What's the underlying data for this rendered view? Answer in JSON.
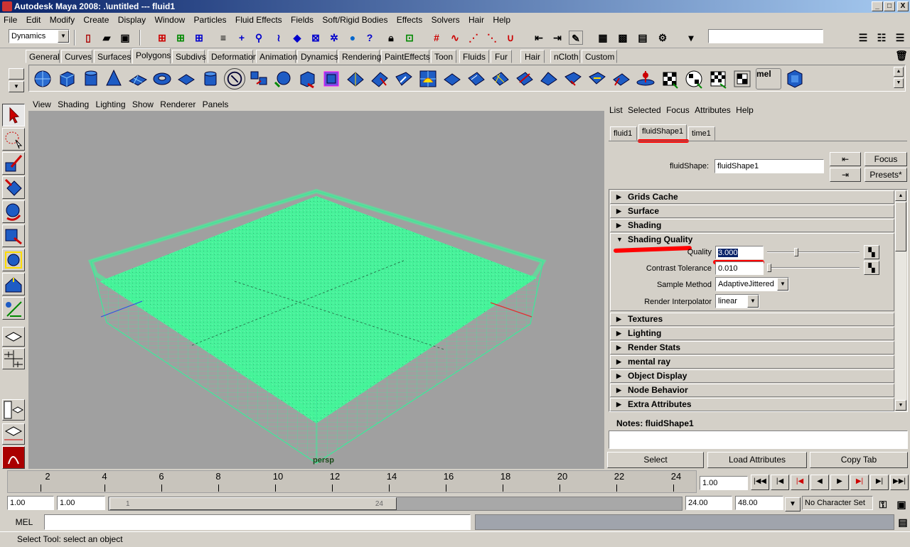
{
  "window": {
    "title": "Autodesk Maya 2008: .\\untitled   ---   fluid1",
    "min": "_",
    "max": "□",
    "close": "X"
  },
  "menubar": [
    "File",
    "Edit",
    "Modify",
    "Create",
    "Display",
    "Window",
    "Particles",
    "Fluid Effects",
    "Fields",
    "Soft/Rigid Bodies",
    "Effects",
    "Solvers",
    "Hair",
    "Help"
  ],
  "status": {
    "menuset": "Dynamics",
    "input_value": ""
  },
  "shelf_tabs": [
    "General",
    "Curves",
    "Surfaces",
    "Polygons",
    "Subdivs",
    "Deformation",
    "Animation",
    "Dynamics",
    "Rendering",
    "PaintEffects",
    "Toon",
    "Fluids",
    "Fur",
    "Hair",
    "nCloth",
    "Custom"
  ],
  "shelf_active": "Polygons",
  "shelf_mel": "mel",
  "panel_menu": [
    "View",
    "Shading",
    "Lighting",
    "Show",
    "Renderer",
    "Panels"
  ],
  "viewport": {
    "camera": "persp"
  },
  "attr_editor": {
    "menu": [
      "List",
      "Selected",
      "Focus",
      "Attributes",
      "Help"
    ],
    "tabs": [
      "fluid1",
      "fluidShape1",
      "time1"
    ],
    "active_tab": "fluidShape1",
    "node_label": "fluidShape:",
    "node_value": "fluidShape1",
    "focus_btn": "Focus",
    "presets_btn": "Presets*",
    "sections_top": [
      "Grids Cache",
      "Surface",
      "Shading"
    ],
    "open_section": "Shading Quality",
    "quality": {
      "label": "Quality",
      "value": "3.000"
    },
    "contrast": {
      "label": "Contrast Tolerance",
      "value": "0.010"
    },
    "sample": {
      "label": "Sample Method",
      "value": "AdaptiveJittered"
    },
    "interp": {
      "label": "Render Interpolator",
      "value": "linear"
    },
    "sections_bottom": [
      "Textures",
      "Lighting",
      "Render Stats",
      "mental ray",
      "Object Display",
      "Node Behavior",
      "Extra Attributes"
    ],
    "notes_label": "Notes:  fluidShape1",
    "select_btn": "Select",
    "load_btn": "Load Attributes",
    "copy_btn": "Copy Tab"
  },
  "timeline": {
    "ticks": [
      "2",
      "4",
      "6",
      "8",
      "10",
      "12",
      "14",
      "16",
      "18",
      "20",
      "22",
      "24"
    ],
    "current": "1.00"
  },
  "range": {
    "start": "1.00",
    "inner_start": "1.00",
    "slider_start": "1",
    "slider_end": "24",
    "end": "24.00",
    "outer_end": "48.00",
    "charset": "No Character Set"
  },
  "mel": {
    "label": "MEL"
  },
  "help_line": "Select Tool: select an object",
  "colors": {
    "fluid": "#44f59a",
    "grid": "#3ee89a",
    "titlebar": "#0a246a",
    "annotation": "#ff0000"
  }
}
